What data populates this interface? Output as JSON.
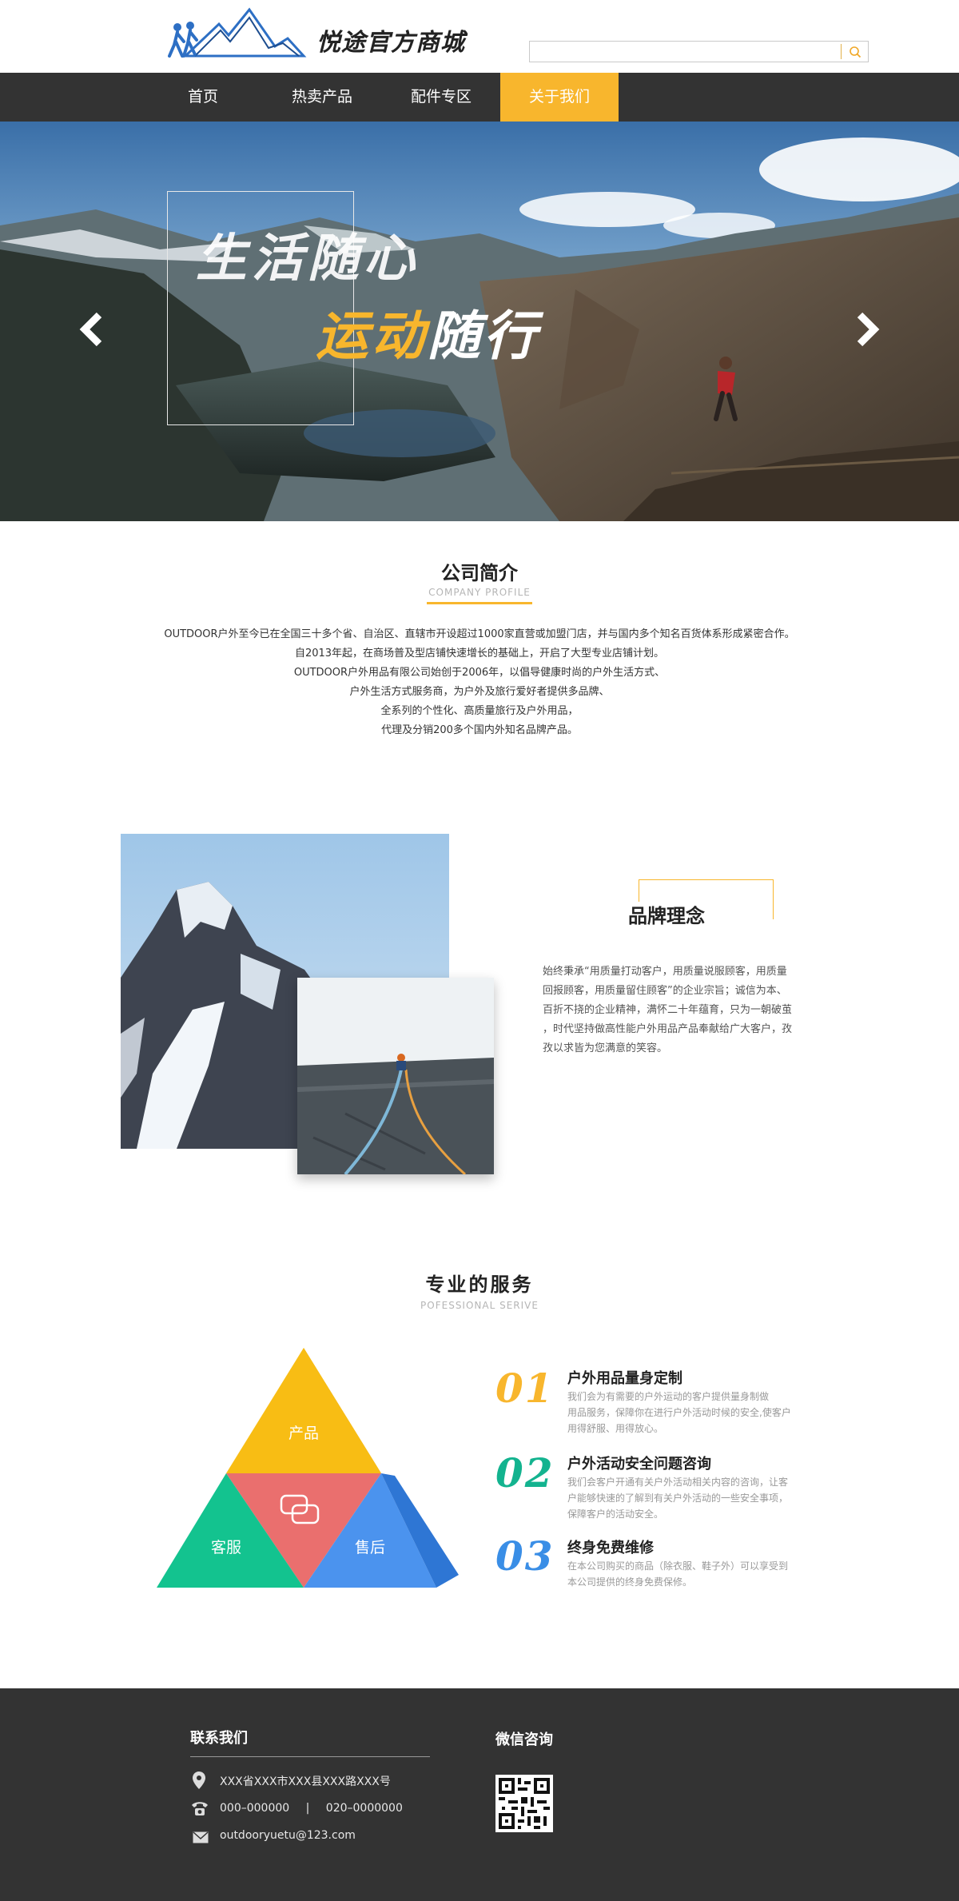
{
  "header": {
    "logo_text": "悦途官方商城",
    "search": {
      "placeholder": "",
      "value": ""
    }
  },
  "nav": {
    "items": [
      {
        "label": "首页"
      },
      {
        "label": "热卖产品"
      },
      {
        "label": "配件专区"
      },
      {
        "label": "关于我们"
      }
    ],
    "active_index": 3
  },
  "banner": {
    "line1": "生活随心",
    "line2_accent": "运动",
    "line2_rest": "随行"
  },
  "company_profile": {
    "title": "公司简介",
    "subtitle": "COMPANY PROFILE",
    "lines": [
      "OUTDOOR户外至今已在全国三十多个省、自治区、直辖市开设超过1000家直营或加盟门店，并与国内多个知名百货体系形成紧密合作。",
      "自2013年起，在商场普及型店铺快速增长的基础上，开启了大型专业店铺计划。",
      "OUTDOOR户外用品有限公司始创于2006年，以倡导健康时尚的户外生活方式、",
      "户外生活方式服务商，为户外及旅行爱好者提供多品牌、",
      "全系列的个性化、高质量旅行及户外用品，",
      "代理及分销200多个国内外知名品牌产品。"
    ]
  },
  "brand": {
    "title": "品牌理念",
    "lines": [
      "始终秉承“用质量打动客户，用质量说服顾客，用质量",
      "回报顾客，用质量留住顾客”的企业宗旨；诚信为本、",
      "百折不挠的企业精神，满怀二十年蕴育，只为一朝破茧",
      "，时代坚持做高性能户外用品产品奉献给广大客户，孜",
      "孜以求皆为您满意的笑容。"
    ]
  },
  "services": {
    "title": "专业的服务",
    "subtitle": "POFESSIONAL SERIVE",
    "pyramid": {
      "top": "产品",
      "left": "客服",
      "right": "售后"
    },
    "items": [
      {
        "num": "01",
        "title": "户外用品量身定制",
        "color": "#f8b62d",
        "desc": [
          "我们会为有需要的户外运动的客户提供量身制做",
          "用品服务，保障你在进行户外活动时候的安全,使客户",
          "用得舒服、用得放心。"
        ]
      },
      {
        "num": "02",
        "title": "户外活动安全问题咨询",
        "color": "#13b38f",
        "desc": [
          "我们会客户开通有关户外活动相关内容的咨询，让客",
          "户能够快速的了解到有关户外活动的一些安全事项，",
          "保障客户的活动安全。"
        ]
      },
      {
        "num": "03",
        "title": "终身免费维修",
        "color": "#3a8ee6",
        "desc": [
          "在本公司购买的商品（除衣服、鞋子外）可以享受到",
          "本公司提供的终身免费保修。"
        ]
      }
    ]
  },
  "footer": {
    "contact_title": "联系我们",
    "address": "XXX省XXX市XXX县XXX路XXX号",
    "phone1": "000–000000",
    "phone_sep": "|",
    "phone2": "020–0000000",
    "email": "outdooryuetu@123.com",
    "wechat_title": "微信咨询"
  },
  "colors": {
    "accent": "#f8b62d",
    "nav_bg": "#333333",
    "footer_bg": "#333333"
  }
}
